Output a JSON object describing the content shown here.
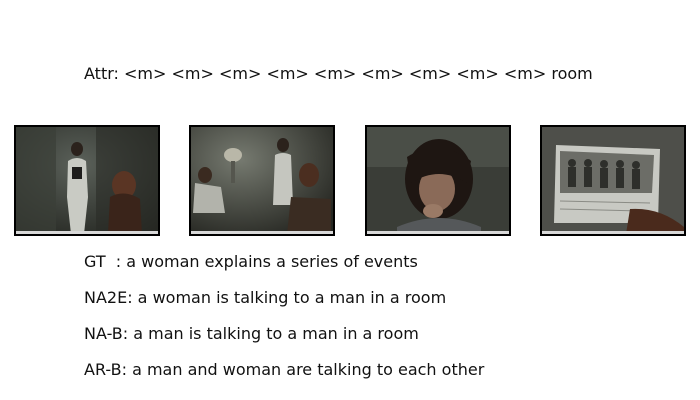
{
  "attr_line": "Attr: <m> <m> <m> <m> <m> <m> <m> <m> <m> room",
  "frames": [
    {
      "description_icon": "video-frame-woman-standing-icon"
    },
    {
      "description_icon": "video-frame-room-scene-icon"
    },
    {
      "description_icon": "video-frame-closeup-face-icon"
    },
    {
      "description_icon": "video-frame-photograph-icon"
    }
  ],
  "captions": {
    "gt": "GT  : a woman explains a series of events",
    "na2e": "NA2E: a woman is talking to a man in a room",
    "na_b": "NA-B: a man is talking to a man in a room",
    "ar_b": "AR-B: a man and woman are talking to each other"
  }
}
